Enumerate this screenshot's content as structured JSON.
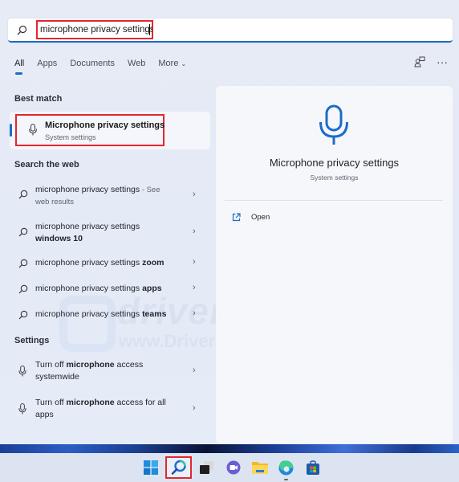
{
  "search": {
    "query": "microphone privacy settings",
    "placeholder": ""
  },
  "tabs": [
    {
      "label": "All",
      "active": true
    },
    {
      "label": "Apps"
    },
    {
      "label": "Documents"
    },
    {
      "label": "Web"
    },
    {
      "label": "More"
    }
  ],
  "header_icons": [
    "account-share-icon",
    "more-options-icon"
  ],
  "sections": {
    "best_match": "Best match",
    "search_web": "Search the web",
    "settings": "Settings"
  },
  "best_match": {
    "title": "Microphone privacy settings",
    "subtitle": "System settings",
    "icon": "microphone-icon"
  },
  "web_results": [
    {
      "prefix": "microphone privacy settings",
      "bold": "",
      "suffix": " - See",
      "sub": "web results"
    },
    {
      "prefix": "microphone privacy settings",
      "bold": "windows 10",
      "suffix": "",
      "sub": ""
    },
    {
      "prefix": "microphone privacy settings ",
      "bold": "zoom",
      "suffix": "",
      "sub": ""
    },
    {
      "prefix": "microphone privacy settings ",
      "bold": "apps",
      "suffix": "",
      "sub": ""
    },
    {
      "prefix": "microphone privacy settings ",
      "bold": "teams",
      "suffix": "",
      "sub": ""
    }
  ],
  "settings_results": [
    {
      "prefix": "Turn off ",
      "bold": "microphone",
      "suffix": " access",
      "line2": "systemwide"
    },
    {
      "prefix": "Turn off ",
      "bold": "microphone",
      "suffix": " access for all",
      "line2": "apps"
    }
  ],
  "preview": {
    "title": "Microphone privacy settings",
    "subtitle": "System settings",
    "actions": [
      {
        "label": "Open",
        "icon": "open-external-icon"
      }
    ]
  },
  "watermark": {
    "brand": "driver easy",
    "url": "www.DriverEasy.com"
  },
  "taskbar": {
    "items": [
      "start-icon",
      "search-icon",
      "task-view-icon",
      "teams-chat-icon",
      "file-explorer-icon",
      "edge-icon",
      "store-icon"
    ]
  },
  "colors": {
    "accent": "#1a6cc8",
    "highlight_box": "#e3262f"
  }
}
